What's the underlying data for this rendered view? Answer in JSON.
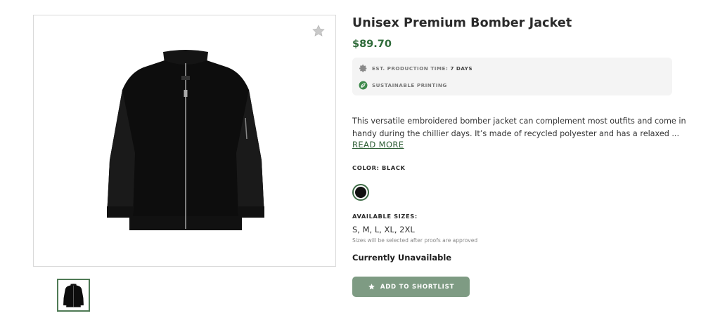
{
  "product": {
    "title": "Unisex Premium Bomber Jacket",
    "price": "$89.70",
    "features": [
      {
        "icon": "gear-icon",
        "label": "EST. PRODUCTION TIME:",
        "value": "7 DAYS"
      },
      {
        "icon": "leaf-icon",
        "label": "SUSTAINABLE PRINTING"
      }
    ],
    "description_lines": [
      "This versatile embroidered bomber jacket can complement most outfits and come in",
      "handy during the chillier days. It’s made of recycled polyester and has a relaxed ..."
    ],
    "read_more": "READ MORE",
    "color_label": "COLOR: BLACK",
    "selected_color": "#111111",
    "sizes_label": "AVAILABLE SIZES:",
    "sizes": "S, M, L, XL, 2XL",
    "sizes_note": "Sizes will be selected after proofs are approved",
    "availability": "Currently Unavailable",
    "shortlist_button": "ADD TO SHORTLIST"
  },
  "colors": {
    "accent_green": "#2f6b3a",
    "button_bg": "#7e9b83",
    "feature_box_bg": "#f4f4f4"
  },
  "icons": {
    "favorite": "star-icon",
    "gallery_thumbnail": "jacket-thumbnail"
  }
}
